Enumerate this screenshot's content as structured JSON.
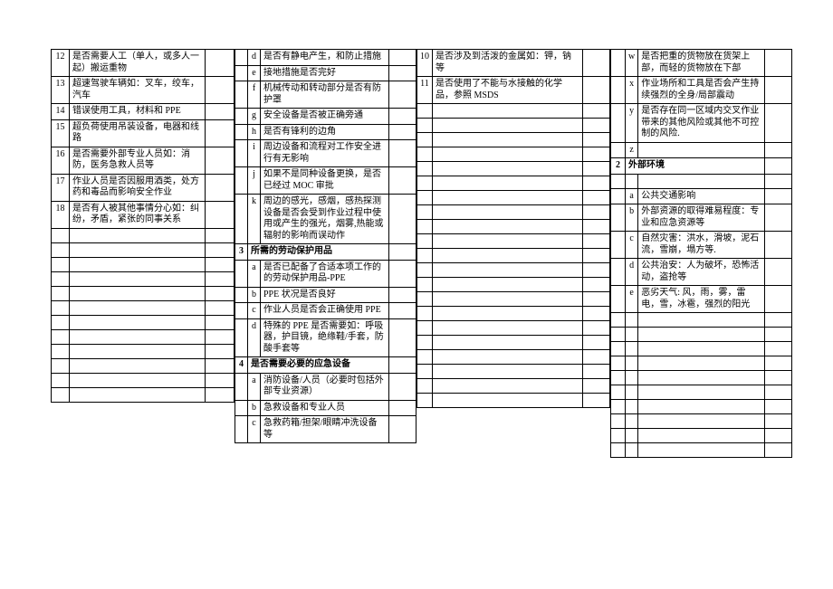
{
  "col1": {
    "rows": [
      {
        "n": "12",
        "t": "是否需要人工（单人，或多人一起）搬运重物"
      },
      {
        "n": "13",
        "t": "超速驾驶车辆如：叉车，绞车，汽车"
      },
      {
        "n": "14",
        "t": "错误使用工具，材料和 PPE"
      },
      {
        "n": "15",
        "t": "超负荷使用吊装设备，电器和线路"
      },
      {
        "n": "16",
        "t": "是否需要外部专业人员如：消防，医务急救人员等"
      },
      {
        "n": "17",
        "t": "作业人员是否因服用酒类，处方药和毒品而影响安全作业"
      },
      {
        "n": "18",
        "t": "是否有人被其他事情分心如：纠纷，矛盾，紧张的同事关系"
      }
    ],
    "blanks": 12
  },
  "col2": {
    "top": [
      {
        "i": "d",
        "t": "是否有静电产生，和防止措施"
      },
      {
        "i": "e",
        "t": "接地措施是否完好"
      },
      {
        "i": "f",
        "t": "机械传动和转动部分是否有防护罩"
      },
      {
        "i": "g",
        "t": "安全设备是否被正确旁通"
      },
      {
        "i": "h",
        "t": "是否有锋利的边角"
      },
      {
        "i": "i",
        "t": "周边设备和流程对工作安全进行有无影响"
      },
      {
        "i": "j",
        "t": "如果不是同种设备更换，是否已经过 MOC 审批"
      },
      {
        "i": "k",
        "t": "周边的感光，感烟，感热探测设备是否会受到作业过程中使用或产生的强光，烟雾,热能或辐射的影响而误动作"
      }
    ],
    "sec3": {
      "n": "3",
      "title": "所需的劳动保护用品",
      "rows": [
        {
          "i": "a",
          "t": "是否已配备了合适本项工作的的劳动保护用品-PPE"
        },
        {
          "i": "b",
          "t": "PPE 状况是否良好"
        },
        {
          "i": "c",
          "t": "作业人员是否会正确使用 PPE"
        },
        {
          "i": "d",
          "t": "特殊的 PPE 是否需要如：呼吸器，护目镜，绝缘鞋/手套，防酸手套等"
        }
      ]
    },
    "sec4": {
      "n": "4",
      "title": "是否需要必要的应急设备",
      "rows": [
        {
          "i": "a",
          "t": "消防设备/人员（必要时包括外部专业资源）"
        },
        {
          "i": "b",
          "t": "急救设备和专业人员"
        },
        {
          "i": "c",
          "t": "急救药箱/担架/眼睛冲洗设备等"
        }
      ]
    }
  },
  "col3": {
    "rows": [
      {
        "n": "10",
        "t": "是否涉及到活泼的金属如：钾，钠等"
      },
      {
        "n": "11",
        "t": "是否使用了不能与水接触的化学品，参照 MSDS"
      }
    ],
    "blanks": 21
  },
  "col4": {
    "top": [
      {
        "i": "w",
        "t": "是否把重的货物放在货架上部，而轻的货物放在下部"
      },
      {
        "i": "x",
        "t": "作业场所和工具是否会产生持续强烈的全身/局部震动"
      },
      {
        "i": "y",
        "t": "是否存在同一区域内交叉作业带来的其他风险或其他不可控制的风险."
      },
      {
        "i": "z",
        "t": ""
      }
    ],
    "sec2": {
      "n": "2",
      "title": "外部环境",
      "rows": [
        {
          "i": "a",
          "t": "公共交通影响"
        },
        {
          "i": "b",
          "t": "外部资源的取得难易程度：专业和应急资源等"
        },
        {
          "i": "c",
          "t": "自然灾害：洪水，滑坡，泥石流，雪崩，塌方等."
        },
        {
          "i": "d",
          "t": "公共治安：人为破坏，恐怖活动，盗抢等"
        },
        {
          "i": "e",
          "t": "恶劣天气: 风，雨，雾，雷电，雪，冰雹，强烈的阳光"
        }
      ]
    },
    "blanks": 10
  }
}
